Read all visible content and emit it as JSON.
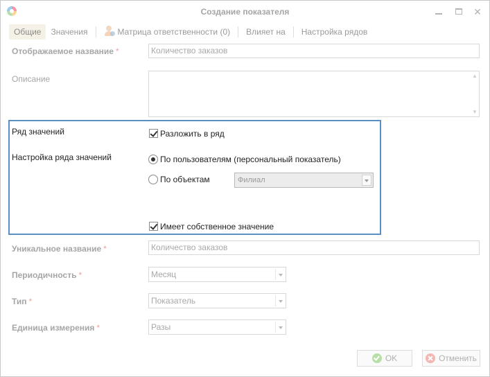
{
  "window": {
    "title": "Создание показателя"
  },
  "tabs": [
    {
      "label": "Общие",
      "active": true
    },
    {
      "label": "Значения",
      "active": false
    },
    {
      "label": "Матрица ответственности (0)",
      "active": false
    },
    {
      "label": "Влияет на",
      "active": false
    },
    {
      "label": "Настройка рядов",
      "active": false
    }
  ],
  "form": {
    "display_name": {
      "label": "Отображаемое название",
      "required": "*",
      "value": "Количество заказов"
    },
    "description": {
      "label": "Описание",
      "value": ""
    },
    "unique_name": {
      "label": "Уникальное название",
      "required": "*",
      "value": "Количество заказов"
    },
    "periodicity": {
      "label": "Периодичность",
      "required": "*",
      "value": "Месяц"
    },
    "type": {
      "label": "Тип",
      "required": "*",
      "value": "Показатель"
    },
    "unit": {
      "label": "Единица измерения",
      "required": "*",
      "value": "Разы"
    }
  },
  "series_group": {
    "series_label": "Ряд значений",
    "split_checkbox": {
      "label": "Разложить в ряд",
      "checked": true
    },
    "series_settings_label": "Настройка ряда значений",
    "by_users_radio": {
      "label": "По пользователям (персональный показатель)",
      "selected": true
    },
    "by_objects_radio": {
      "label": "По объектам",
      "selected": false
    },
    "objects_select": {
      "value": "Филиал"
    },
    "own_value_checkbox": {
      "label": "Имеет собственное значение",
      "checked": true
    }
  },
  "footer": {
    "ok_label": "OK",
    "cancel_label": "Отменить"
  },
  "colors": {
    "group_border": "#5b8ec2",
    "active_tab_bg": "#f6f1e6",
    "required_asterisk": "#f0a0a0"
  }
}
